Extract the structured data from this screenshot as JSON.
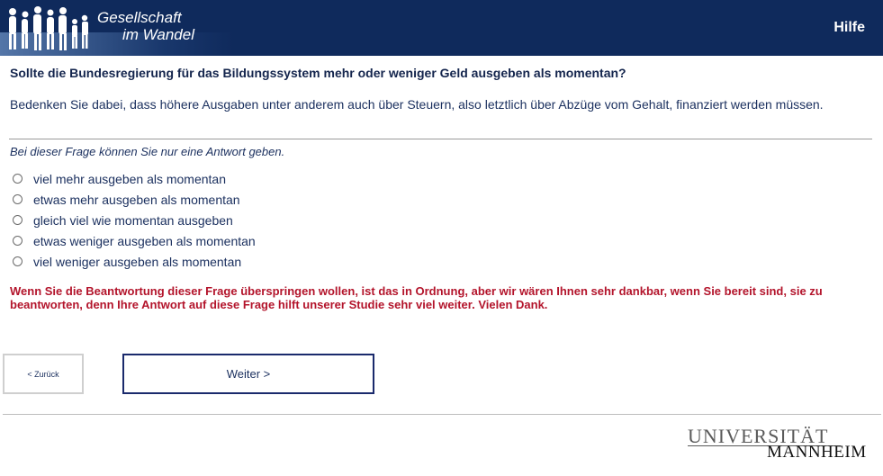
{
  "header": {
    "logo_line1": "Gesellschaft",
    "logo_line2": "im Wandel",
    "help_label": "Hilfe",
    "background_color": "#0f2a5c"
  },
  "question": {
    "title": "Sollte die Bundesregierung für das Bildungssystem mehr oder weniger Geld ausgeben als momentan?",
    "hint": "Bedenken Sie dabei, dass höhere Ausgaben unter anderem auch über Steuern, also letztlich über Abzüge vom Gehalt, finanziert werden müssen.",
    "instruction": "Bei dieser Frage können Sie nur eine Antwort geben.",
    "options": [
      "viel mehr ausgeben als momentan",
      "etwas mehr ausgeben als momentan",
      "gleich viel wie momentan ausgeben",
      "etwas weniger ausgeben als momentan",
      "viel weniger ausgeben als momentan"
    ],
    "notice": "Wenn Sie die Beantwortung dieser Frage überspringen wollen, ist das in Ordnung, aber wir wären Ihnen sehr dankbar, wenn Sie bereit sind, sie zu beantworten, denn Ihre Antwort auf diese Frage hilft unserer Studie sehr viel weiter. Vielen Dank.",
    "notice_color": "#b3142b"
  },
  "navigation": {
    "back_label": "< Zurück",
    "next_label": "Weiter >"
  },
  "footer": {
    "logo_top": "UNIVERSITÄT",
    "logo_bottom": "MANNHEIM"
  }
}
